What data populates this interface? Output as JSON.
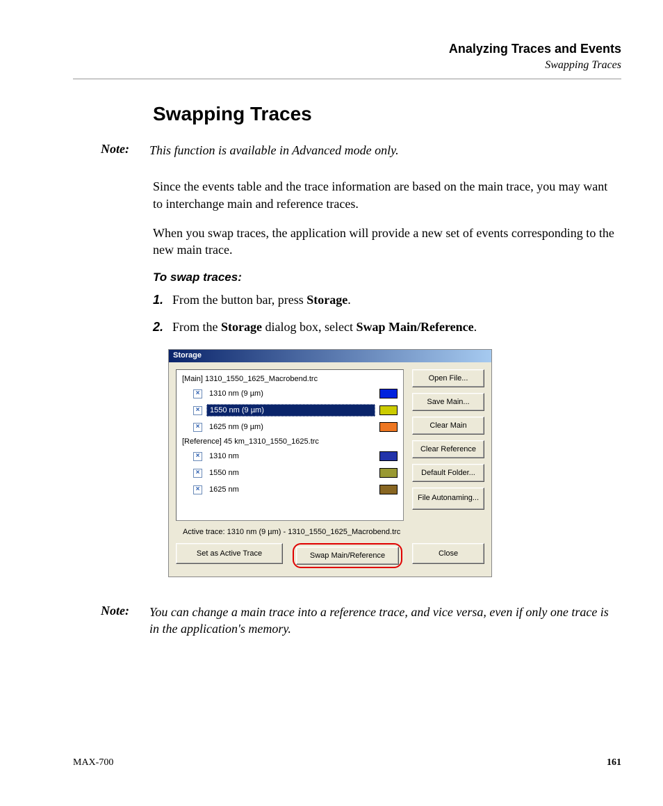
{
  "header": {
    "chapter": "Analyzing Traces and Events",
    "section": "Swapping Traces"
  },
  "title": "Swapping Traces",
  "note1": {
    "label": "Note:",
    "text": "This function is available in Advanced mode only."
  },
  "para1": "Since the events table and the trace information are based on the main trace, you may want to interchange main and reference traces.",
  "para2": "When you swap traces, the application will provide a new set of events corresponding to the new main trace.",
  "proc_heading": "To swap traces:",
  "steps": [
    {
      "num": "1.",
      "pre": "From the button bar, press ",
      "bold": "Storage",
      "post": "."
    },
    {
      "num": "2.",
      "pre": "From the ",
      "bold1": "Storage",
      "mid": " dialog box, select ",
      "bold2": "Swap Main/Reference",
      "post": "."
    }
  ],
  "dialog": {
    "title": "Storage",
    "main_header": "[Main] 1310_1550_1625_Macrobend.trc",
    "main_items": [
      {
        "label": "1310 nm (9 µm)",
        "color": "#0022dd",
        "selected": false
      },
      {
        "label": "1550 nm (9 µm)",
        "color": "#cccc00",
        "selected": true
      },
      {
        "label": "1625 nm (9 µm)",
        "color": "#ee7722",
        "selected": false
      }
    ],
    "ref_header": "[Reference] 45 km_1310_1550_1625.trc",
    "ref_items": [
      {
        "label": "1310 nm",
        "color": "#2233aa"
      },
      {
        "label": "1550 nm",
        "color": "#999933"
      },
      {
        "label": "1625 nm",
        "color": "#886622"
      }
    ],
    "buttons": {
      "open": "Open File...",
      "save": "Save Main...",
      "clear_main": "Clear Main",
      "clear_ref": "Clear Reference",
      "default_folder": "Default Folder...",
      "autonaming": "File Autonaming..."
    },
    "active_label": "Active trace: 1310 nm (9 µm) - 1310_1550_1625_Macrobend.trc",
    "bottom": {
      "set_active": "Set as Active Trace",
      "swap": "Swap Main/Reference",
      "close": "Close"
    }
  },
  "note2": {
    "label": "Note:",
    "text": "You can change a main trace into a reference trace, and vice versa, even if only one trace is in the application's memory."
  },
  "footer": {
    "left": "MAX-700",
    "right": "161"
  }
}
